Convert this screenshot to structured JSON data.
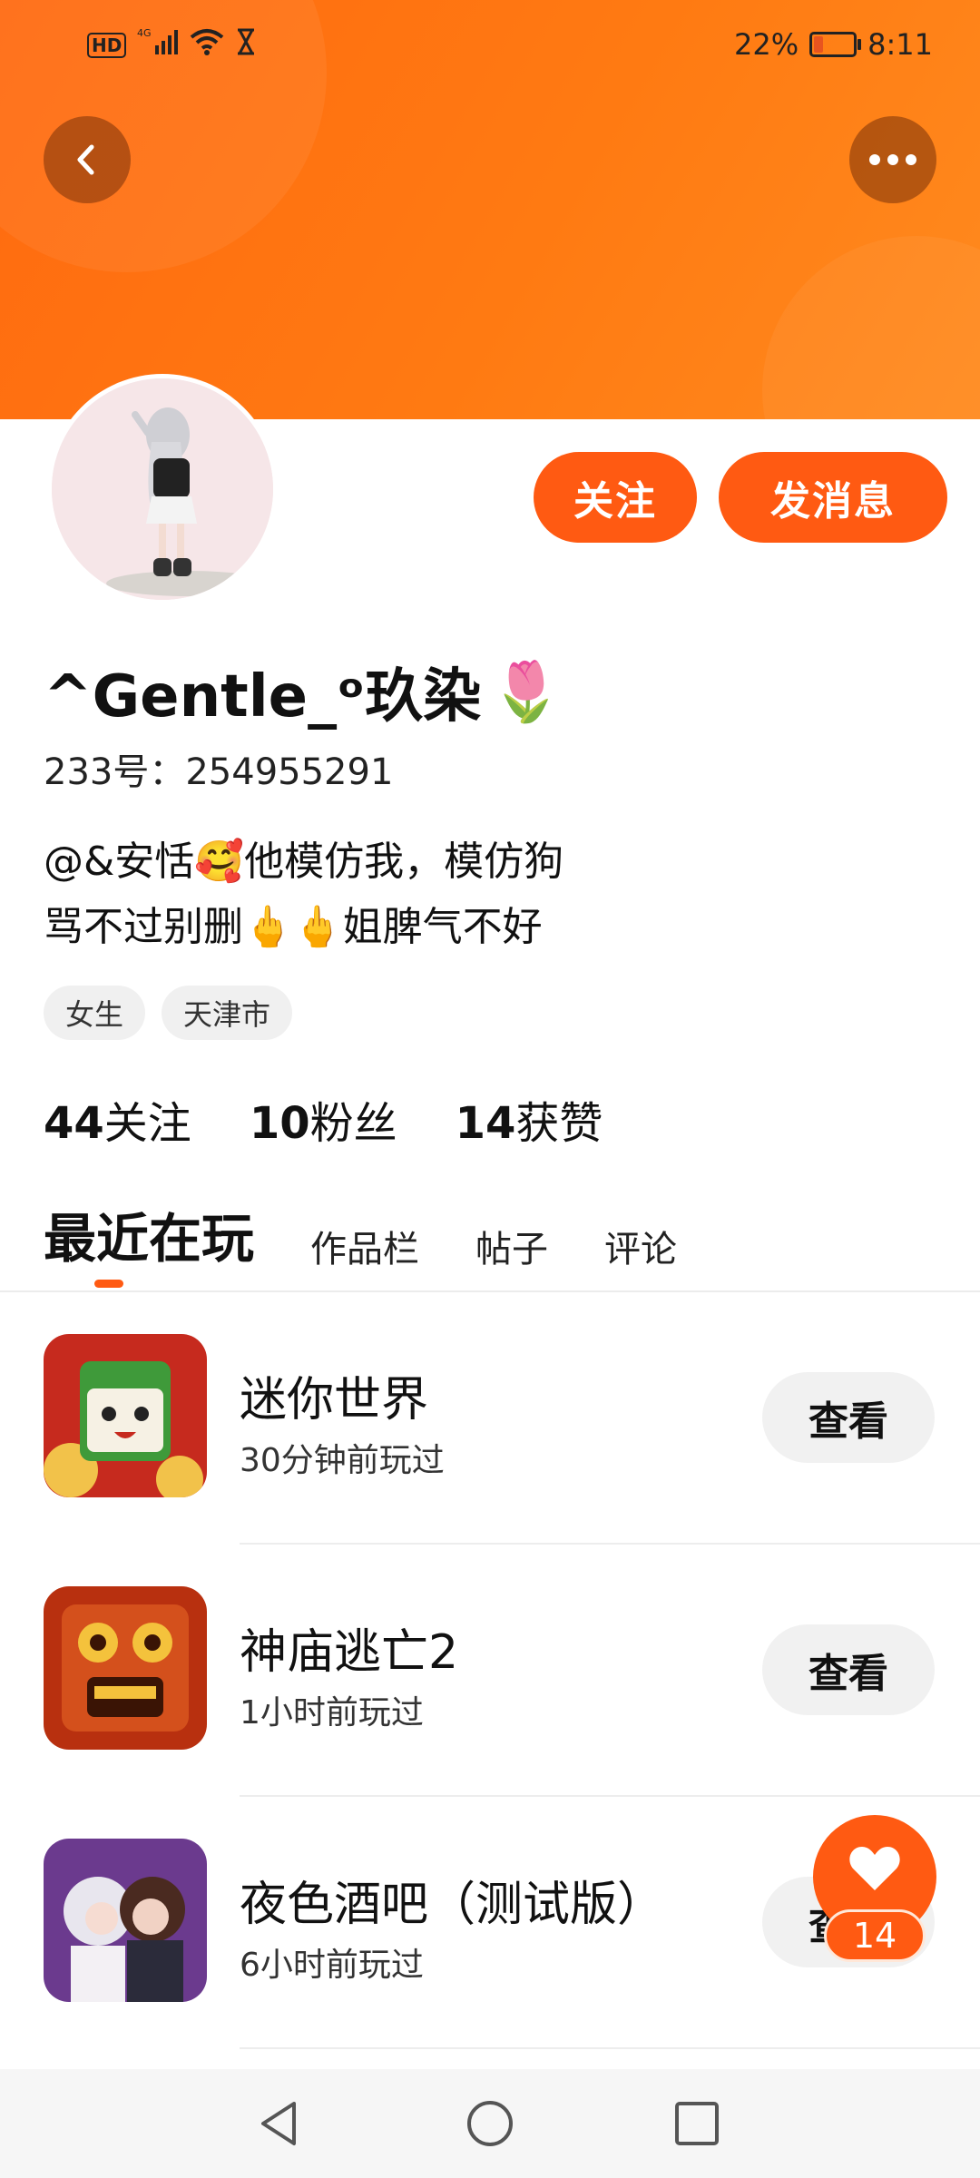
{
  "status_bar": {
    "network": "4G",
    "battery": "22%",
    "battery_level": 0.22,
    "time": "8:11"
  },
  "colors": {
    "accent": "#ff5a12",
    "banner_start": "#ff6a10",
    "banner_end": "#ff8a1e"
  },
  "profile": {
    "username": "^Gentle_ᵒ玖染",
    "username_emoji": "🌷",
    "id_label": "233号：",
    "id_value": "254955291",
    "bio_line1": "@&安恬🥰他模仿我，模仿狗",
    "bio_line2": "骂不过别删🖕🖕姐脾气不好",
    "tags": [
      "女生",
      "天津市"
    ],
    "stats": [
      {
        "value": "44",
        "label": "关注"
      },
      {
        "value": "10",
        "label": "粉丝"
      },
      {
        "value": "14",
        "label": "获赞"
      }
    ]
  },
  "actions": {
    "follow": "关注",
    "message": "发消息"
  },
  "tabs": [
    "最近在玩",
    "作品栏",
    "帖子",
    "评论"
  ],
  "games": [
    {
      "name": "迷你世界",
      "time": "30分钟前玩过",
      "action": "查看",
      "icon": "mini-world-icon"
    },
    {
      "name": "神庙逃亡2",
      "time": "1小时前玩过",
      "action": "查看",
      "icon": "temple-run-2-icon"
    },
    {
      "name": "夜色酒吧（测试版）",
      "time": "6小时前玩过",
      "action": "查看",
      "icon": "night-bar-icon"
    }
  ],
  "like_fab": {
    "count": "14",
    "icon": "heart-icon"
  },
  "navbar": {
    "icons": [
      "back-triangle-icon",
      "home-circle-icon",
      "recent-square-icon"
    ]
  }
}
